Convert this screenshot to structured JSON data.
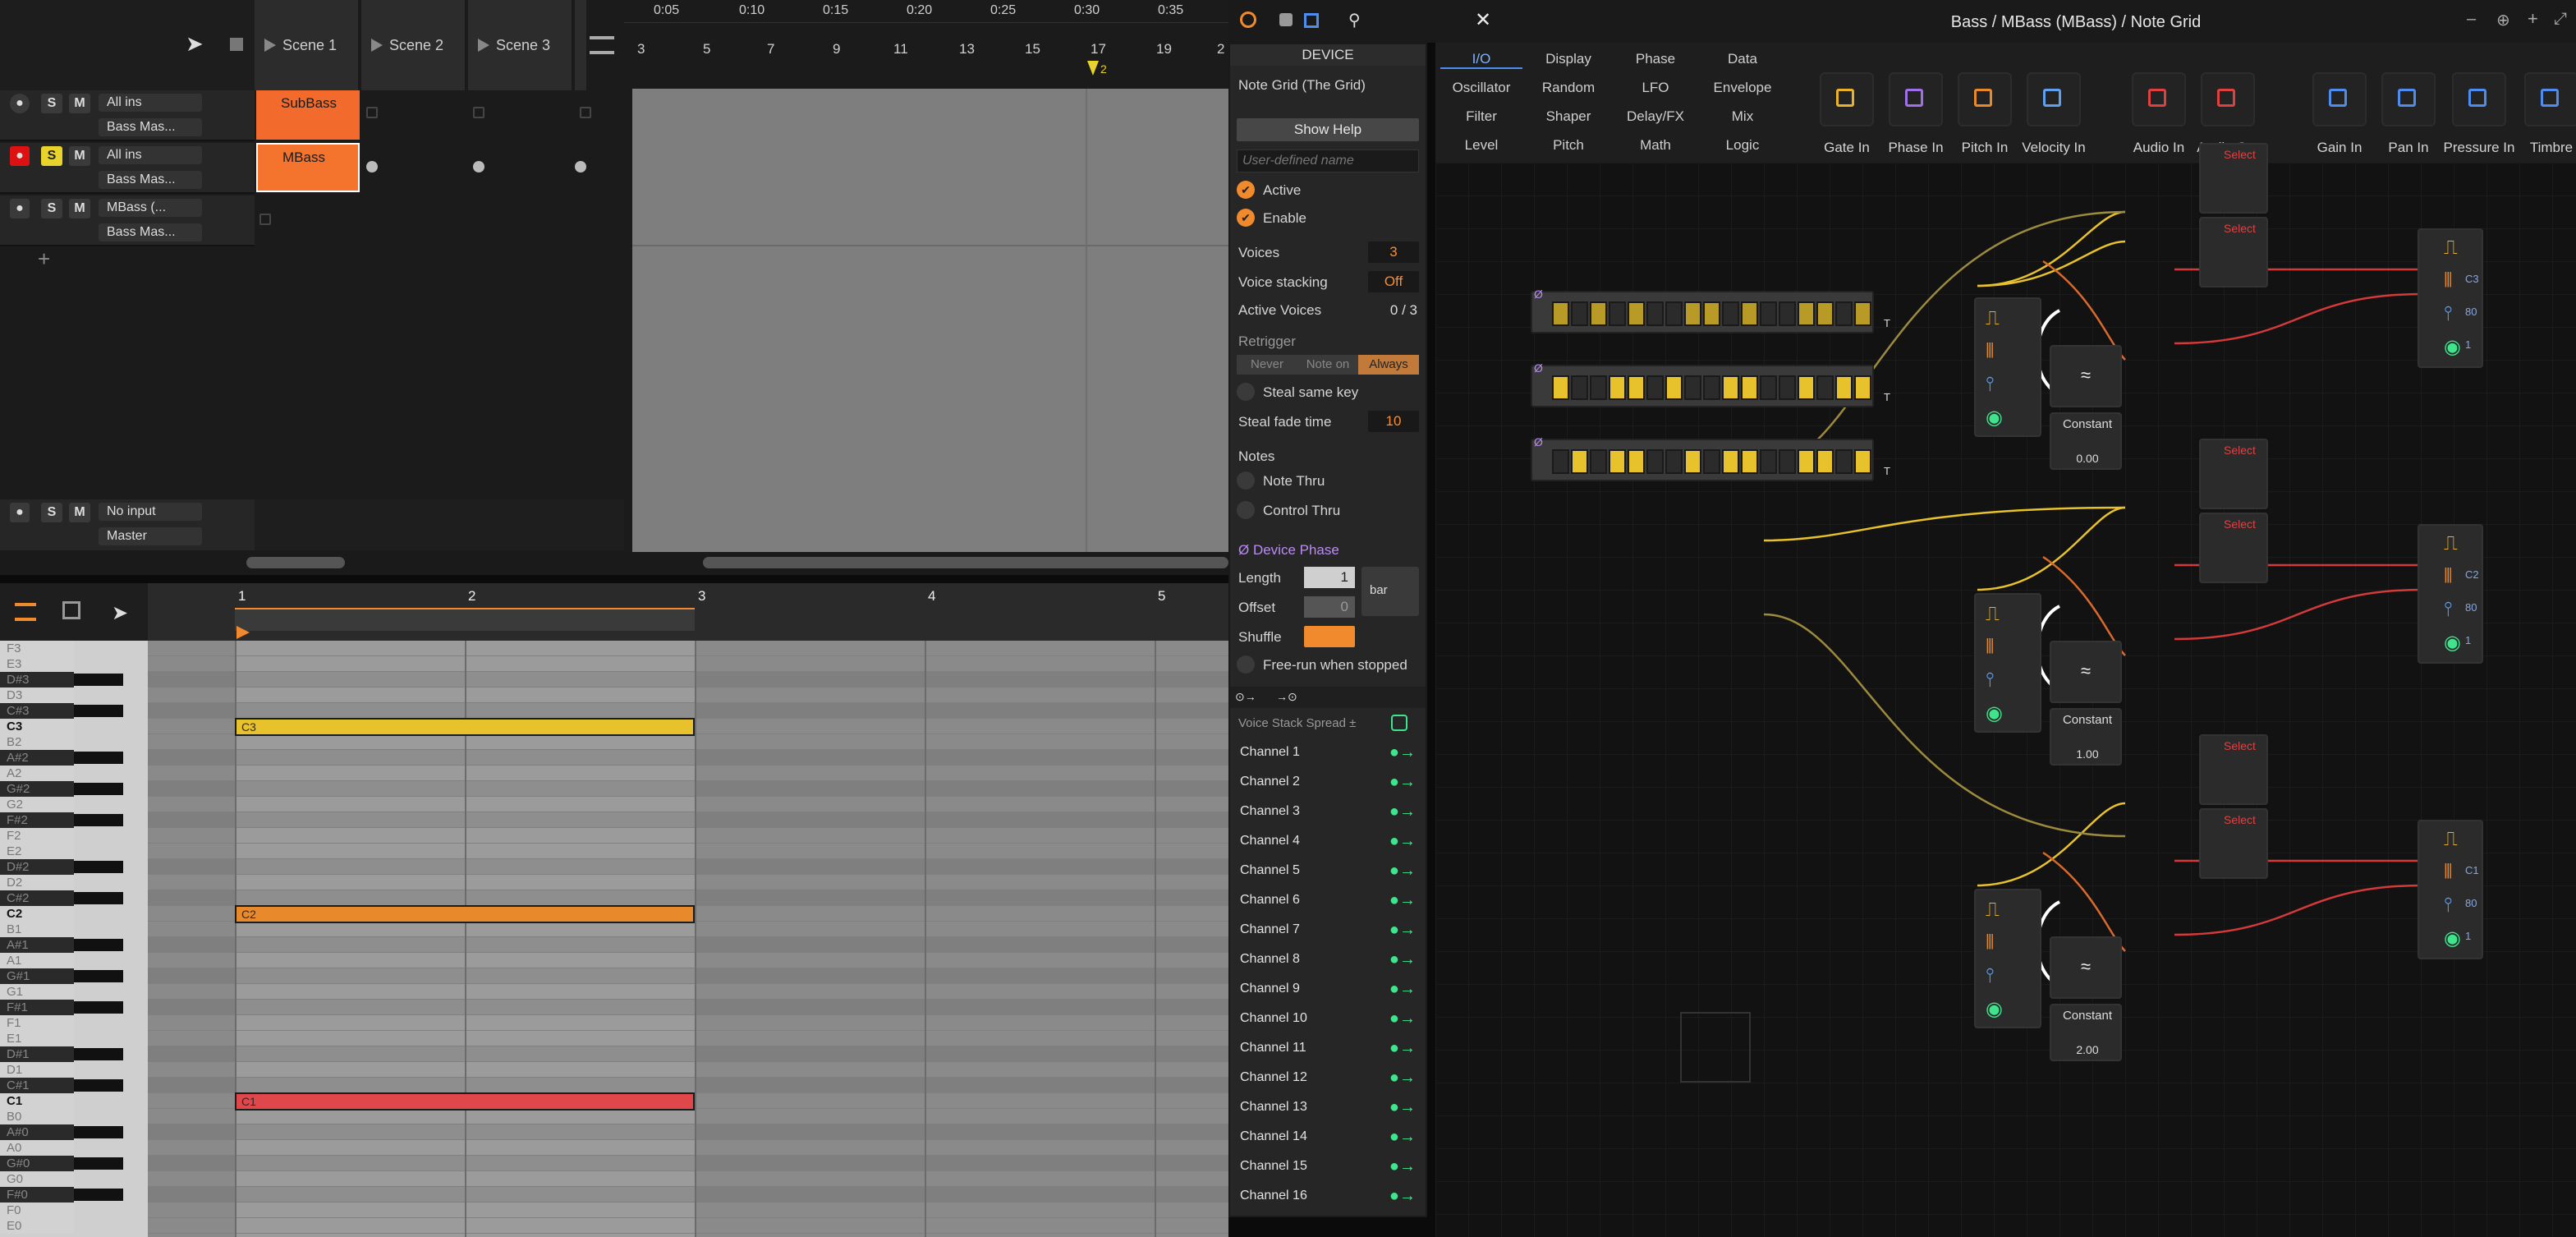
{
  "window": {
    "title": "Bass / MBass (MBass) / Note Grid"
  },
  "scenes": [
    "Scene 1",
    "Scene 2",
    "Scene 3"
  ],
  "tracks": [
    {
      "input": "All ins",
      "output": "Bass Mas...",
      "clip": "SubBass",
      "solo": "S",
      "mute": "M"
    },
    {
      "input": "All ins",
      "output": "Bass Mas...",
      "clip": "MBass",
      "solo": "S",
      "mute": "M"
    },
    {
      "input": "MBass (...",
      "output": "Bass Mas...",
      "clip": "",
      "solo": "S",
      "mute": "M"
    }
  ],
  "master": {
    "input": "No input",
    "output": "Master",
    "solo": "S",
    "mute": "M"
  },
  "timeline": {
    "time_labels": [
      "0:05",
      "0:10",
      "0:15",
      "0:20",
      "0:25",
      "0:30",
      "0:35"
    ],
    "bar_labels": [
      "3",
      "5",
      "7",
      "9",
      "11",
      "13",
      "15",
      "17",
      "19",
      "2"
    ],
    "marker": "2"
  },
  "piano_roll": {
    "bar_labels": [
      "1",
      "2",
      "3",
      "4",
      "5"
    ],
    "keys": [
      "F3",
      "E3",
      "D#3",
      "D3",
      "C#3",
      "C3",
      "B2",
      "A#2",
      "A2",
      "G#2",
      "G2",
      "F#2",
      "F2",
      "E2",
      "D#2",
      "D2",
      "C#2",
      "C2",
      "B1",
      "A#1",
      "A1",
      "G#1",
      "G1",
      "F#1",
      "F1",
      "E1",
      "D#1",
      "D1",
      "C#1",
      "C1",
      "B0",
      "A#0",
      "A0",
      "G#0",
      "G0",
      "F#0",
      "F0",
      "E0"
    ],
    "notes": [
      {
        "label": "C3",
        "color": "#e8c22c"
      },
      {
        "label": "C2",
        "color": "#e88a2c"
      },
      {
        "label": "C1",
        "color": "#e0474a"
      }
    ]
  },
  "device": {
    "header": "DEVICE",
    "name": "Note Grid (The Grid)",
    "show_help": "Show Help",
    "user_name_placeholder": "User-defined name",
    "active": "Active",
    "enable": "Enable",
    "voices_label": "Voices",
    "voices": "3",
    "voice_stacking_label": "Voice stacking",
    "voice_stacking": "Off",
    "active_voices_label": "Active Voices",
    "active_voices": "0 / 3",
    "retrigger_label": "Retrigger",
    "retrigger_opts": [
      "Never",
      "Note on",
      "Always"
    ],
    "steal_same_key": "Steal same key",
    "steal_fade_label": "Steal fade time",
    "steal_fade": "10",
    "notes_label": "Notes",
    "note_thru": "Note Thru",
    "control_thru": "Control Thru",
    "phase_header": "Ø Device Phase",
    "length_label": "Length",
    "length": "1",
    "length_unit": "bar",
    "offset_label": "Offset",
    "offset": "0",
    "shuffle_label": "Shuffle",
    "freerun": "Free-run when stopped",
    "spread_label": "Voice Stack Spread ±",
    "channels": [
      "Channel 1",
      "Channel 2",
      "Channel 3",
      "Channel 4",
      "Channel 5",
      "Channel 6",
      "Channel 7",
      "Channel 8",
      "Channel 9",
      "Channel 10",
      "Channel 11",
      "Channel 12",
      "Channel 13",
      "Channel 14",
      "Channel 15",
      "Channel 16"
    ]
  },
  "grid": {
    "categories": [
      [
        "I/O",
        "Display",
        "Phase",
        "Data"
      ],
      [
        "Oscillator",
        "Random",
        "LFO",
        "Envelope"
      ],
      [
        "Filter",
        "Shaper",
        "Delay/FX",
        "Mix"
      ],
      [
        "Level",
        "Pitch",
        "Math",
        "Logic"
      ]
    ],
    "io_modules": [
      "Gate In",
      "Phase In",
      "Pitch In",
      "Velocity In",
      "Audio In",
      "Audio Out",
      "Gain In",
      "Pan In",
      "Pressure In",
      "Timbre"
    ],
    "select_label": "Select",
    "constant_label": "Constant",
    "constants": [
      "0.00",
      "1.00",
      "2.00"
    ],
    "outputs": [
      {
        "pitch": "C3",
        "velocity": "80",
        "channel": "1"
      },
      {
        "pitch": "C2",
        "velocity": "80",
        "channel": "1"
      },
      {
        "pitch": "C1",
        "velocity": "80",
        "channel": "1"
      }
    ],
    "seq_tag": "T"
  }
}
